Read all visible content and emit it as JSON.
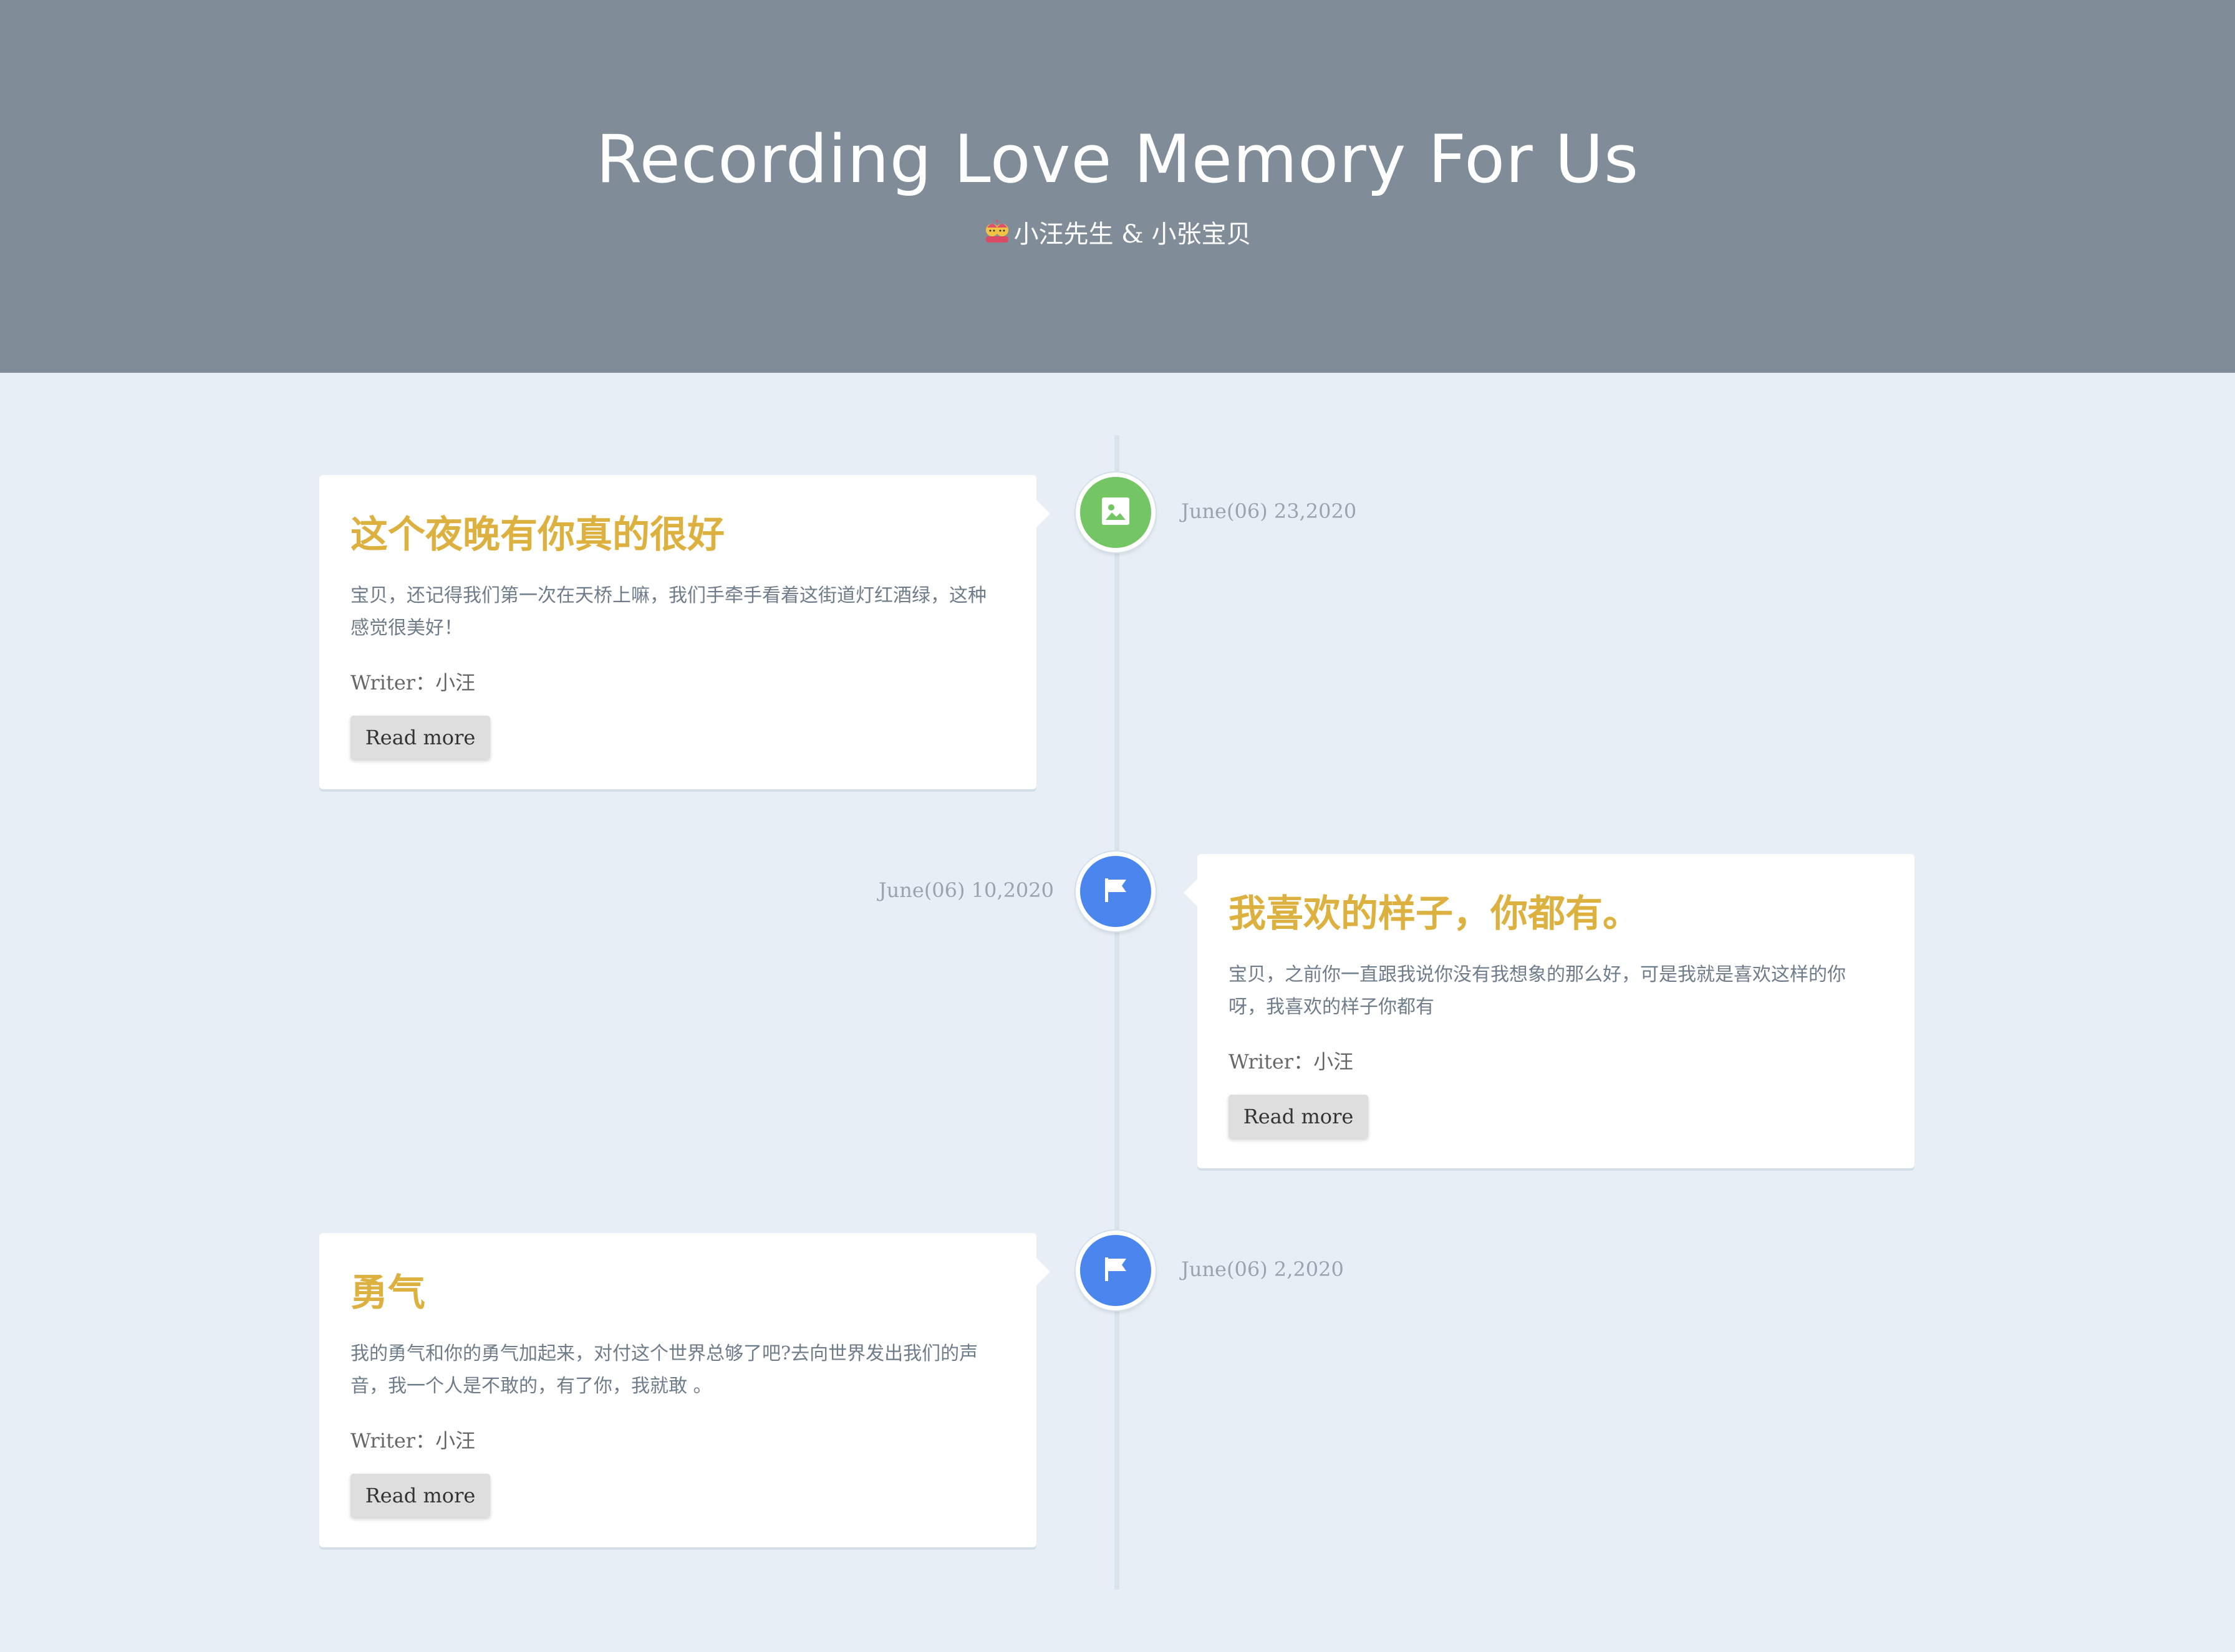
{
  "header": {
    "title": "Recording Love Memory For Us",
    "subtitle": "小汪先生 & 小张宝贝",
    "subtitle_icon": "couple-emoji-icon",
    "background_color": "#808c98"
  },
  "page": {
    "background_color": "#e7eef5",
    "accent_title_color": "#dcb13f"
  },
  "timeline": [
    {
      "title": "这个夜晚有你真的很好",
      "text": "宝贝，还记得我们第一次在天桥上嘛，我们手牵手看着这街道灯红酒绿，这种感觉很美好！",
      "writer": "Writer：小汪",
      "read_more": "Read more",
      "date": "June(06) 23,2020",
      "icon": "image-icon",
      "icon_color": "#74c564",
      "side": "left"
    },
    {
      "title": "我喜欢的样子，你都有。",
      "text": "宝贝，之前你一直跟我说你没有我想象的那么好，可是我就是喜欢这样的你呀，我喜欢的样子你都有",
      "writer": "Writer：小汪",
      "read_more": "Read more",
      "date": "June(06) 10,2020",
      "icon": "flag-icon",
      "icon_color": "#4b86ef",
      "side": "right"
    },
    {
      "title": "勇气",
      "text": "我的勇气和你的勇气加起来，对付这个世界总够了吧?去向世界发出我们的声音，我一个人是不敢的，有了你，我就敢 。",
      "writer": "Writer：小汪",
      "read_more": "Read more",
      "date": "June(06) 2,2020",
      "icon": "flag-icon",
      "icon_color": "#4b86ef",
      "side": "left"
    }
  ]
}
